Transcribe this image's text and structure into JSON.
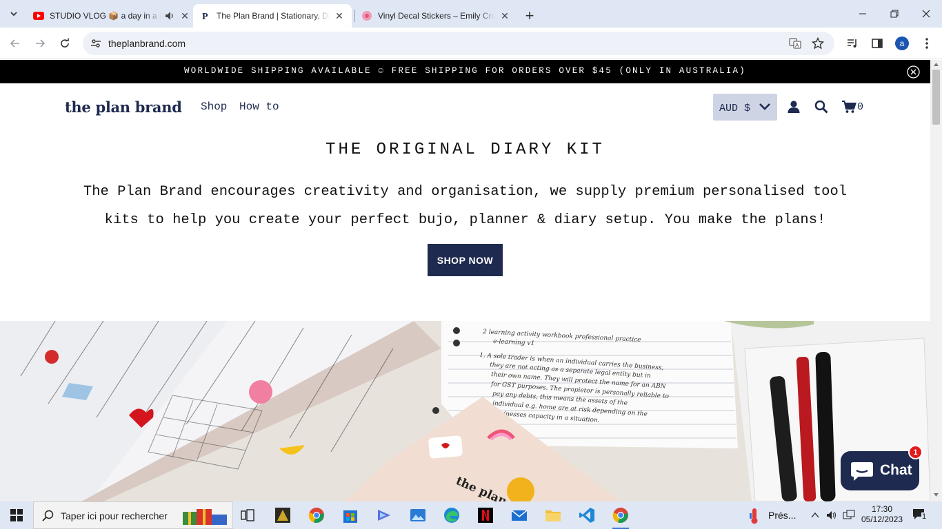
{
  "browser": {
    "tabs": [
      {
        "title": "STUDIO VLOG 📦 a day in a life",
        "audio": true,
        "favicon": "youtube-icon"
      },
      {
        "title": "The Plan Brand | Stationary, Diary Kits",
        "active": true,
        "favicon": "plan-brand-p-icon"
      },
      {
        "title": "Vinyl Decal Stickers – Emily Cromwell",
        "favicon": "flower-icon"
      }
    ],
    "new_tab_label": "+",
    "url": "theplanbrand.com",
    "profile_initial": "a"
  },
  "page": {
    "announcement": "WORLDWIDE SHIPPING AVAILABLE ☺ FREE SHIPPING FOR ORDERS OVER $45 (ONLY IN AUSTRALIA)",
    "logo": "the plan brand",
    "nav": [
      {
        "label": "Shop"
      },
      {
        "label": "How to"
      }
    ],
    "currency": "AUD $",
    "cart_count": "0",
    "hero": {
      "title": "THE ORIGINAL DIARY KIT",
      "description": "The Plan Brand encourages creativity and organisation, we supply premium personalised tool kits to help you create your perfect bujo, planner & diary setup. You make the plans!",
      "cta": "SHOP NOW"
    },
    "photo_notebook_text": "the plan",
    "photo_note_lines": [
      "2  learning activity workbook professional practice",
      "e-learning v1",
      "1.  A sole trader is when an individual carries the business,",
      "they are not acting as a separate legal entity but in",
      "their own name. They will protect the name for an ABN",
      "for GST purposes. The propietor is personally reliable to",
      "pay any debts, this means the assets of the",
      "individual e.g. home are at risk depending on the",
      "businesses capacity in a situation."
    ],
    "chat": {
      "label": "Chat",
      "badge": "1"
    }
  },
  "taskbar": {
    "search_placeholder": "Taper ici pour rechercher",
    "weather": "Prés...",
    "time": "17:30",
    "date": "05/12/2023",
    "notifications": "1"
  },
  "colors": {
    "brand_navy": "#1e2a4f",
    "announcement_bg": "#000000",
    "currency_bg": "#cfd4e4",
    "chrome_bg": "#dfe7f5"
  }
}
